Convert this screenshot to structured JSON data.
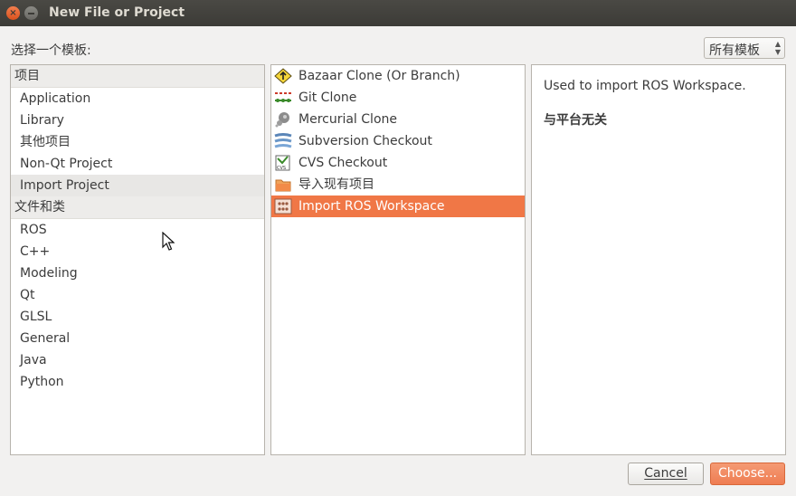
{
  "window": {
    "title": "New File or Project"
  },
  "prompt": "选择一个模板:",
  "filter": {
    "selected": "所有模板"
  },
  "categories": {
    "projects_header": "项目",
    "projects": [
      "Application",
      "Library",
      "其他项目",
      "Non-Qt Project",
      "Import Project"
    ],
    "files_header": "文件和类",
    "files": [
      "ROS",
      "C++",
      "Modeling",
      "Qt",
      "GLSL",
      "General",
      "Java",
      "Python"
    ],
    "selected": "Import Project"
  },
  "wizards": [
    {
      "label": "Bazaar Clone (Or Branch)",
      "icon": "bazaar-icon"
    },
    {
      "label": "Git Clone",
      "icon": "git-icon"
    },
    {
      "label": "Mercurial Clone",
      "icon": "mercurial-icon"
    },
    {
      "label": "Subversion Checkout",
      "icon": "subversion-icon"
    },
    {
      "label": "CVS Checkout",
      "icon": "cvs-icon"
    },
    {
      "label": "导入现有项目",
      "icon": "folder-icon"
    },
    {
      "label": "Import ROS Workspace",
      "icon": "ros-icon"
    }
  ],
  "selected_wizard": "Import ROS Workspace",
  "description": {
    "text": "Used to import ROS Workspace.",
    "platform": "与平台无关"
  },
  "buttons": {
    "cancel": "Cancel",
    "choose": "Choose..."
  },
  "colors": {
    "accent": "#f07746",
    "titlebar": "#3c3b37"
  }
}
